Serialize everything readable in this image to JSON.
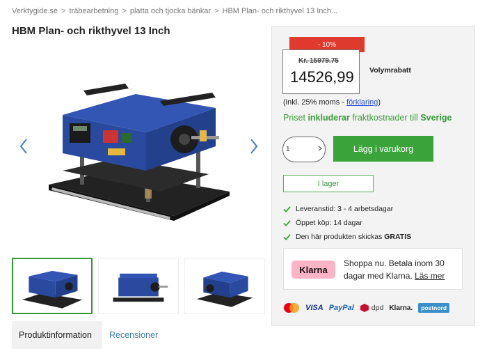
{
  "breadcrumb": {
    "items": [
      "Verktygide.se",
      "träbearbetning",
      "platta och tjocka bänkar",
      "HBM Plan- och rikthyvel 13 Inch..."
    ],
    "separator": ">"
  },
  "product": {
    "title": "HBM Plan- och rikthyvel 13 Inch"
  },
  "pricing": {
    "discount": "- 10%",
    "old_price": "Kr. 15979.75",
    "price": "14526,99",
    "volume_discount": "Volymrabatt",
    "vat_prefix": "(inkl. 25% moms - ",
    "vat_link": "förklaring",
    "vat_suffix": ")",
    "shipping": {
      "part1": "Priset ",
      "bold1": "inkluderar",
      "part2": " fraktkostnader till ",
      "bold2": "Sverige"
    }
  },
  "cart": {
    "quantity": "1",
    "add_label": "Lägg i varukorg",
    "stock_label": "I lager"
  },
  "features": [
    "Leveranstid: 3 - 4 arbetsdagar",
    "Öppet köp: 14 dagar",
    "Den här produkten skickas GRATIS"
  ],
  "klarna": {
    "logo": "Klarna",
    "text": "Shoppa nu. Betala inom 30 dagar med Klarna.",
    "link": "Läs mer"
  },
  "payment_logos": [
    "VISA",
    "PayPal",
    "dpd",
    "Klarna.",
    "postnord"
  ],
  "tabs": [
    "Produktinformation",
    "Recensioner"
  ],
  "colors": {
    "accent_green": "#3aa33a",
    "discount_red": "#e03a2f",
    "klarna_pink": "#ffb3c7",
    "product_blue": "#2a4aa0"
  },
  "icons": [
    "chevron-left-icon",
    "chevron-right-icon",
    "check-icon",
    "mastercard-icon",
    "dpd-cube-icon"
  ]
}
